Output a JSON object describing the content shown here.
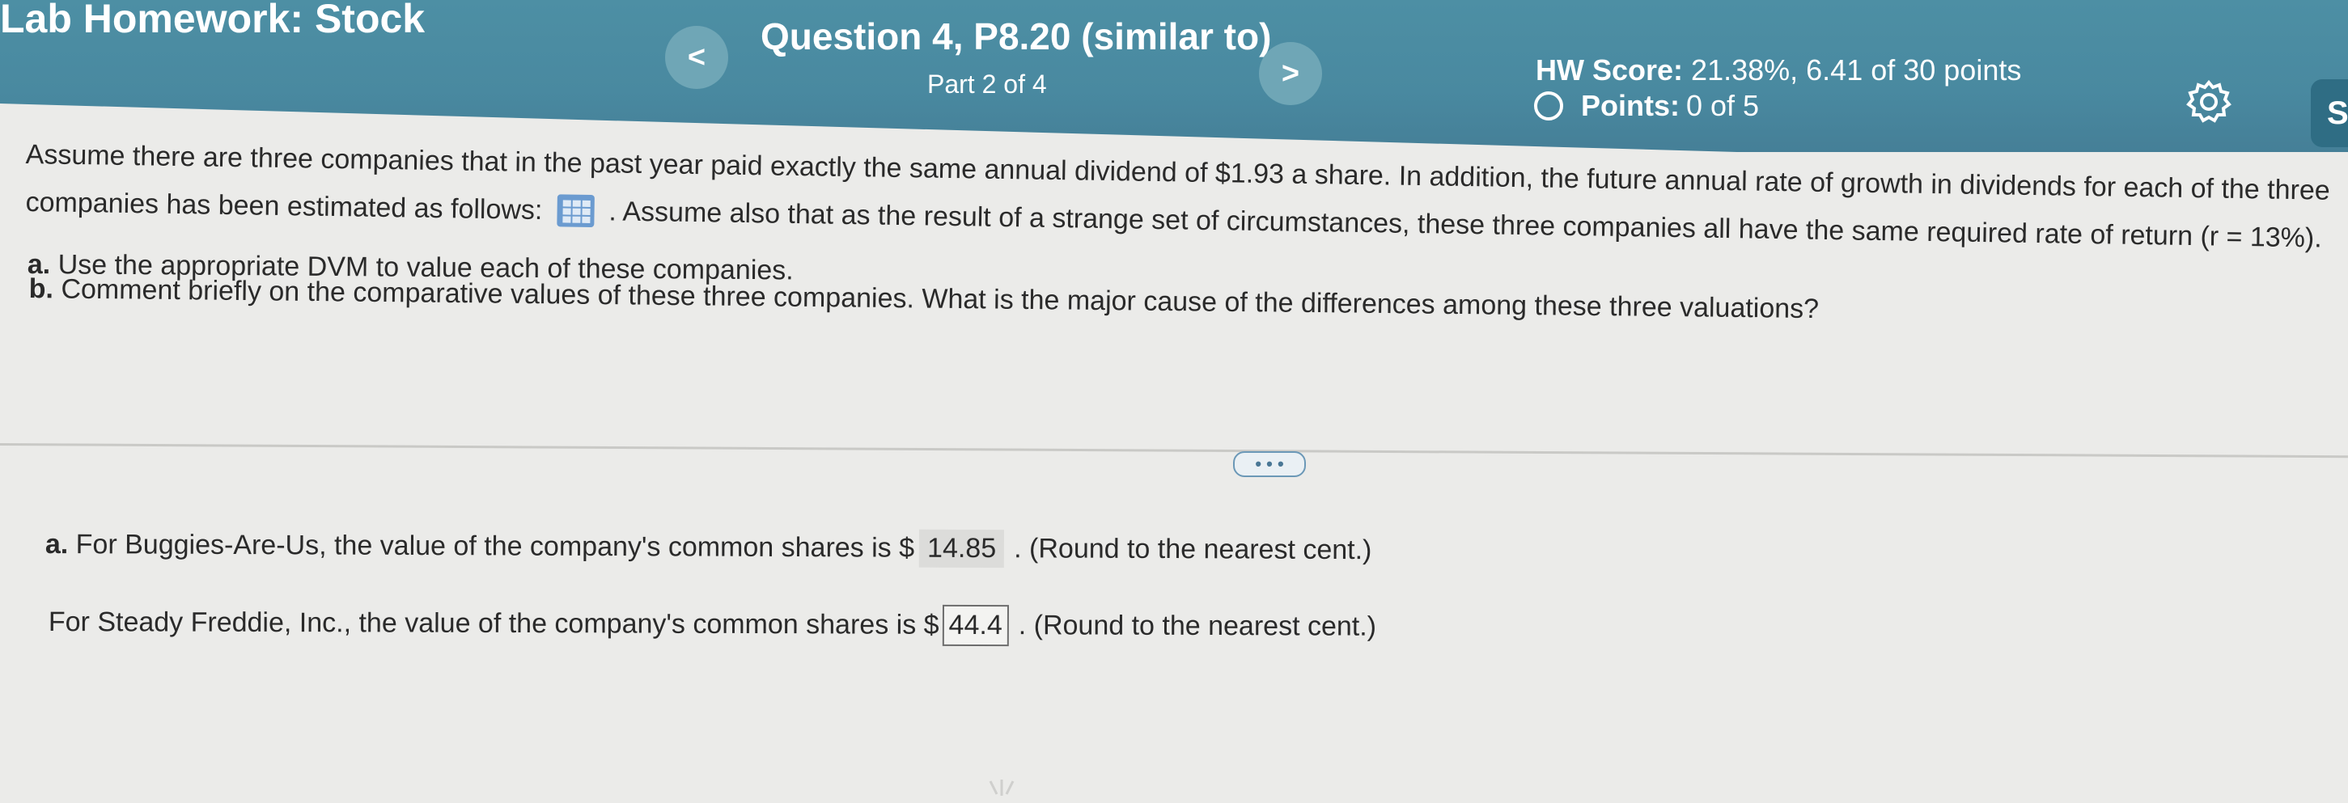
{
  "header": {
    "hw_title": "Lab Homework: Stock",
    "question_title": "Question 4, P8.20 (similar to)",
    "question_part": "Part 2 of 4",
    "prev_icon": "<",
    "next_icon": ">",
    "hw_score_label": "HW Score:",
    "hw_score_value": "21.38%, 6.41 of 30 points",
    "points_label": "Points:",
    "points_value": "0 of 5",
    "profile_initial": "S",
    "settings_icon": "gear-icon"
  },
  "question": {
    "line1": "Assume there are three companies that in the past year paid exactly the same annual dividend of $1.93 a share. In addition, the future annual rate of growth in dividends for each of the three",
    "line2_start": "companies has been estimated as follows:",
    "line2_end": ". Assume also that as the result of a strange set of circumstances, these three companies all have the same required rate of return (r = 13%).",
    "line3_label": "a.",
    "line3_text": "Use the appropriate DVM to value each of these companies.",
    "line4_label": "b.",
    "line4_text": "Comment briefly on the comparative values of these three companies. What is the major cause of the differences among these three valuations?",
    "more_label": "• • •"
  },
  "answers": {
    "a1_label": "a.",
    "a1_text": "For Buggies-Are-Us, the value of the company's common shares is $",
    "a1_value": "14.85",
    "a1_note": ".  (Round to the nearest cent.)",
    "a2_text": "For Steady Freddie, Inc., the value of the company's common shares is $",
    "a2_value": "44.4",
    "a2_note": ".  (Round to the nearest cent.)"
  }
}
